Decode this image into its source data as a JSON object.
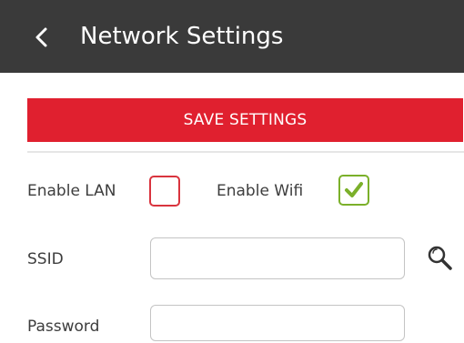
{
  "header": {
    "title": "Network Settings",
    "back_icon": "chevron-left-icon",
    "background": "#3a3a3a"
  },
  "toolbar": {
    "save_label": "SAVE SETTINGS",
    "save_color": "#e0202f"
  },
  "form": {
    "enable_lan": {
      "label": "Enable LAN",
      "checked": false,
      "border_color": "#d9343e"
    },
    "enable_wifi": {
      "label": "Enable Wifi",
      "checked": true,
      "check_color": "#7bb02a"
    },
    "ssid": {
      "label": "SSID",
      "value": "",
      "search_icon": "search-icon"
    },
    "password": {
      "label": "Password",
      "value": ""
    }
  }
}
